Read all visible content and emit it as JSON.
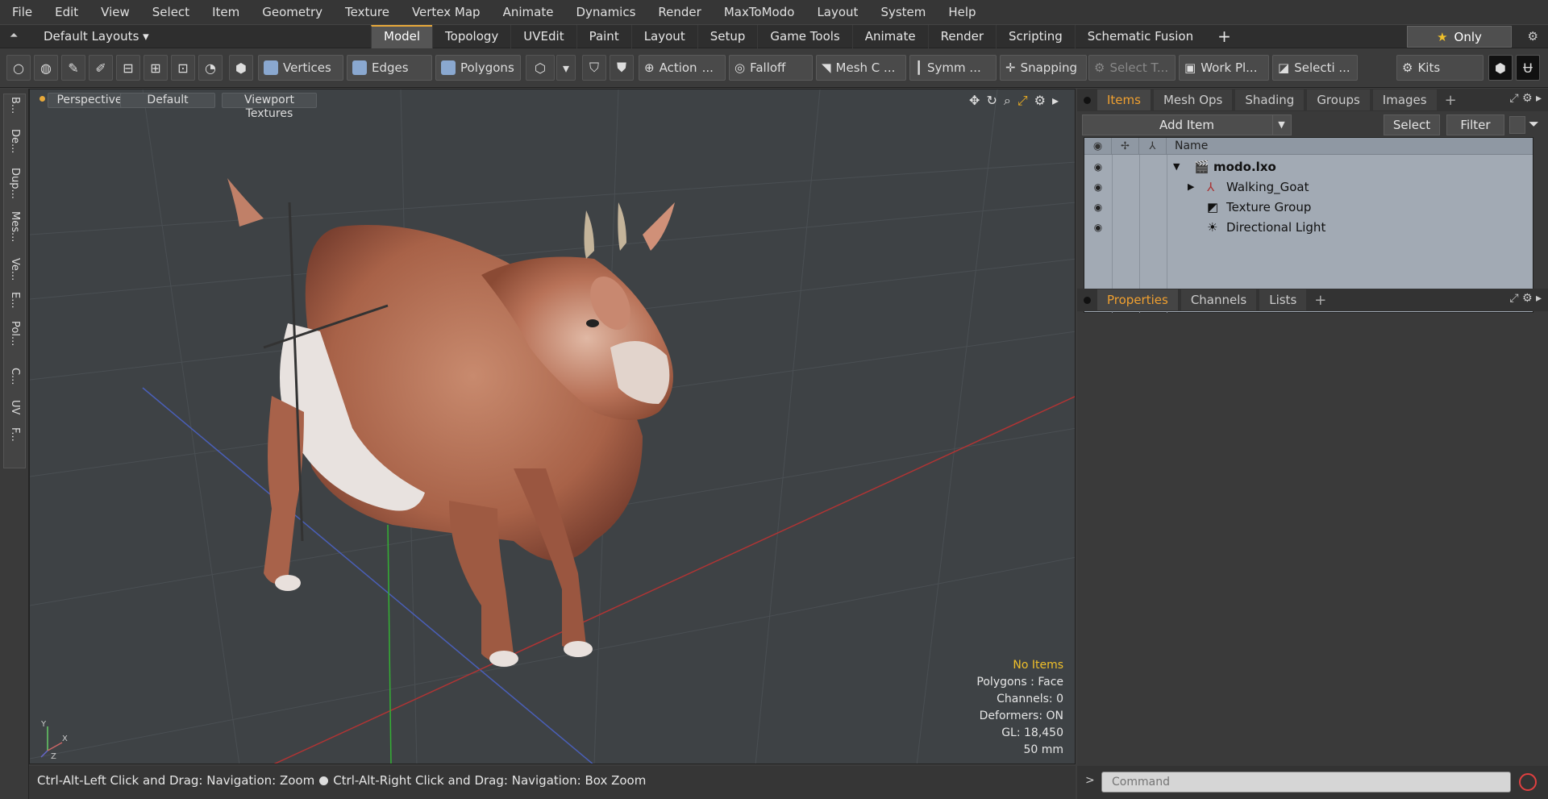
{
  "menu": [
    "File",
    "Edit",
    "View",
    "Select",
    "Item",
    "Geometry",
    "Texture",
    "Vertex Map",
    "Animate",
    "Dynamics",
    "Render",
    "MaxToModo",
    "Layout",
    "System",
    "Help"
  ],
  "layoutbar": {
    "layout_label": "Default Layouts ▾",
    "tabs": [
      "Model",
      "Topology",
      "UVEdit",
      "Paint",
      "Layout",
      "Setup",
      "Game Tools",
      "Animate",
      "Render",
      "Scripting",
      "Schematic Fusion"
    ],
    "only_label": "Only"
  },
  "toolbar": {
    "vertices": "Vertices",
    "edges": "Edges",
    "polygons": "Polygons",
    "action": "Action",
    "action_more": "...",
    "falloff": "Falloff",
    "mesh": "Mesh C ...",
    "symm": "Symm ...",
    "snapping": "Snapping",
    "select_t": "Select T...",
    "workplane": "Work Pl...",
    "selecti": "Selecti ...",
    "kits": "Kits"
  },
  "left_tabs": [
    "B...",
    "De...",
    "Dup...",
    "Mes...",
    "Ve...",
    "E...",
    "Pol...",
    "C...",
    "UV",
    "F..."
  ],
  "viewport": {
    "perspective": "Perspective",
    "default": "Default",
    "textures": "Viewport Textures",
    "info": {
      "no_items": "No Items",
      "polygons": "Polygons : Face",
      "channels": "Channels: 0",
      "deformers": "Deformers: ON",
      "gl": "GL: 18,450",
      "scale": "50 mm"
    },
    "axis_x": "X",
    "axis_y": "Y",
    "axis_z": "Z"
  },
  "status": {
    "left": "Ctrl-Alt-Left Click and Drag: Navigation: Zoom",
    "right": "Ctrl-Alt-Right Click and Drag: Navigation: Box Zoom"
  },
  "items_panel": {
    "tabs": [
      "Items",
      "Mesh Ops",
      "Shading",
      "Groups",
      "Images"
    ],
    "add_item": "Add Item",
    "select": "Select",
    "filter": "Filter",
    "name_header": "Name",
    "rows": [
      "modo.lxo",
      "Walking_Goat",
      "Texture Group",
      "Directional Light"
    ]
  },
  "props_panel": {
    "tabs": [
      "Properties",
      "Channels",
      "Lists"
    ]
  },
  "command": {
    "placeholder": "Command"
  }
}
